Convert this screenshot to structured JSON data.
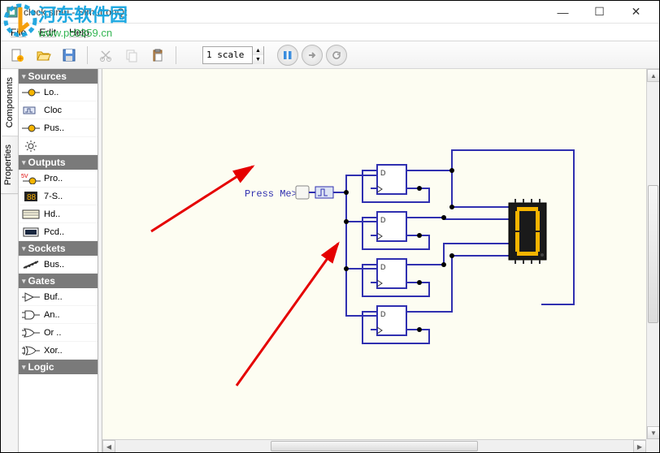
{
  "window": {
    "title": "clock.simu - SimutronQt",
    "min": "—",
    "max": "☐",
    "close": "✕"
  },
  "menu": {
    "file": "File",
    "edit": "Edit",
    "help": "Help"
  },
  "toolbar": {
    "scale_value": "1 scale"
  },
  "vtabs": {
    "components": "Components",
    "properties": "Properties"
  },
  "sidebar": {
    "groups": [
      {
        "name": "Sources",
        "items": [
          {
            "label": "Lo..",
            "icon": "logic-source"
          },
          {
            "label": "Cloc",
            "icon": "clock"
          },
          {
            "label": "Pus..",
            "icon": "push"
          },
          {
            "label": "",
            "icon": "sun"
          }
        ]
      },
      {
        "name": "Outputs",
        "items": [
          {
            "label": "Pro..",
            "icon": "probe"
          },
          {
            "label": "7-S..",
            "icon": "sevenseg"
          },
          {
            "label": "Hd..",
            "icon": "lcd"
          },
          {
            "label": "Pcd..",
            "icon": "display"
          }
        ]
      },
      {
        "name": "Sockets",
        "items": [
          {
            "label": "Bus..",
            "icon": "bus"
          }
        ]
      },
      {
        "name": "Gates",
        "items": [
          {
            "label": "Buf..",
            "icon": "buffer"
          },
          {
            "label": "An..",
            "icon": "and"
          },
          {
            "label": "Or ..",
            "icon": "or"
          },
          {
            "label": "Xor..",
            "icon": "xor"
          }
        ]
      },
      {
        "name": "Logic",
        "items": []
      }
    ],
    "outputs_5v": "5V"
  },
  "canvas": {
    "press_me": "Press Me>",
    "seven_seg_value": "0"
  },
  "watermark": {
    "cn": "河东软件园",
    "url": "www.pc0359.cn"
  }
}
